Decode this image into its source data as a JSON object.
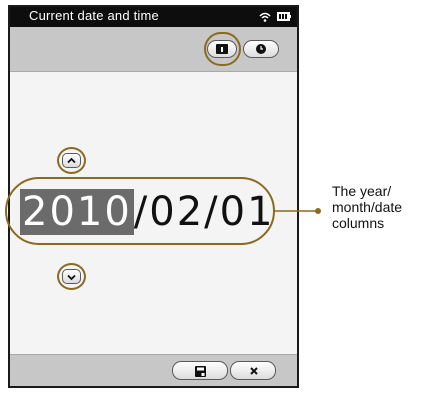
{
  "status_bar": {
    "title": "Current date and time"
  },
  "date_display": {
    "year": "2010",
    "rest": "/02/01"
  },
  "annotation": {
    "label_line1": "The year/",
    "label_line2": "month/date",
    "label_line3": "columns"
  }
}
